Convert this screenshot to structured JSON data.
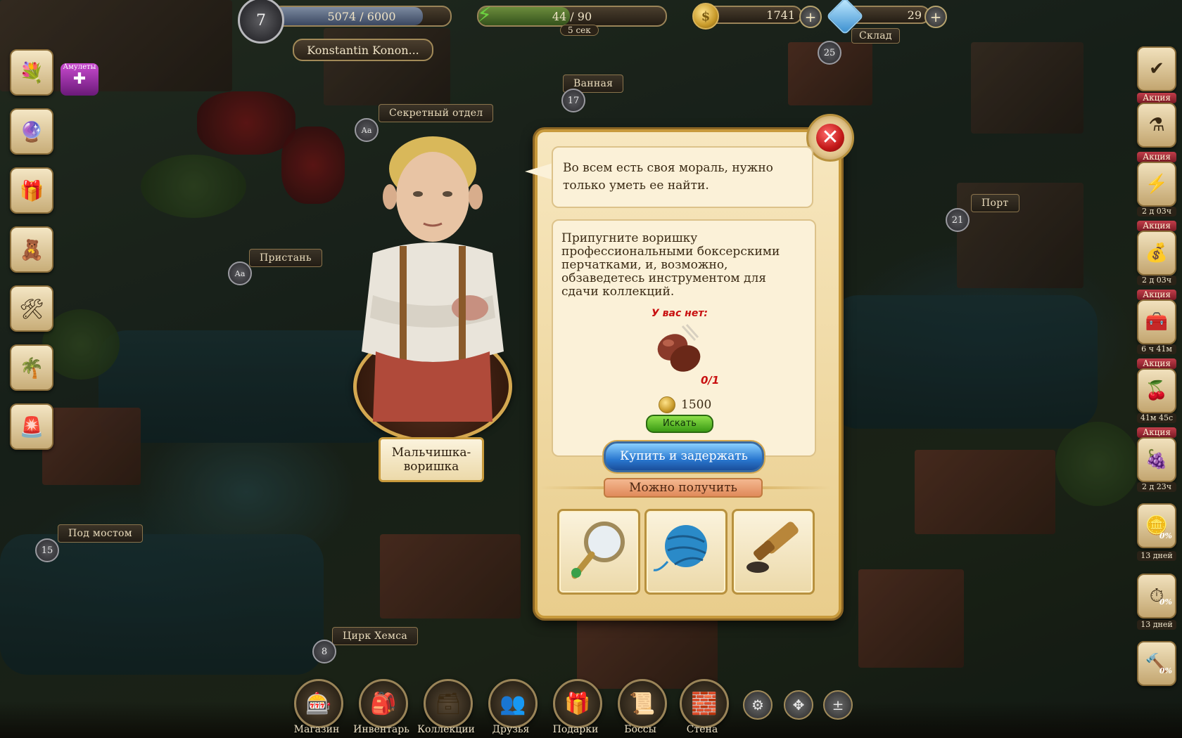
{
  "hud": {
    "level": "7",
    "xp_text": "5074 / 6000",
    "xp_fraction": 0.846,
    "energy_text": "44 / 90",
    "energy_fraction": 0.49,
    "energy_timer": "5 сек",
    "coins": "1741",
    "gems": "29",
    "player_name": "Konstantin Konon...",
    "warehouse_label": "Склад",
    "warehouse_level": "25"
  },
  "map": {
    "locations": [
      {
        "label": "Ванная",
        "level": "17"
      },
      {
        "label": "Секретный отдел",
        "level": "Аа"
      },
      {
        "label": "Пристань",
        "level": "Аа"
      },
      {
        "label": "Порт",
        "level": "21"
      },
      {
        "label": "Под мостом",
        "level": "15"
      },
      {
        "label": "Цирк Хемса",
        "level": "8"
      }
    ],
    "amulets_label": "Амулеты"
  },
  "right_panel": {
    "promo_label": "Акция",
    "timers": [
      "2 д 03ч",
      "2 д 03ч",
      "6 ч 41м",
      "41м 45с",
      "2 д 23ч",
      "13 дней",
      "13 дней"
    ],
    "percents": [
      "0%",
      "0%",
      "0%"
    ]
  },
  "character": {
    "name": "Мальчишка-воришка"
  },
  "dialog": {
    "quote": "Во всем есть своя мораль, нужно только уметь ее найти.",
    "task_text": "Припугните воришку профессиональными боксерскими перчатками, и, возможно, обзаведетесь инструментом для сдачи коллекций.",
    "missing_label": "У вас нет:",
    "item_count": "0/1",
    "price": "1500",
    "search_button": "Искать",
    "buy_button": "Купить и задержать",
    "can_get_label": "Можно получить",
    "rewards": [
      "magnifier-icon",
      "yarn-ball-icon",
      "spyglass-icon"
    ]
  },
  "bottom_nav": [
    {
      "label": "Магазин",
      "icon": "shop-icon"
    },
    {
      "label": "Инвентарь",
      "icon": "inventory-icon"
    },
    {
      "label": "Коллекции",
      "icon": "collections-icon"
    },
    {
      "label": "Друзья",
      "icon": "friends-icon"
    },
    {
      "label": "Подарки",
      "icon": "gifts-icon"
    },
    {
      "label": "Боссы",
      "icon": "bosses-icon"
    },
    {
      "label": "Стена",
      "icon": "wall-icon"
    }
  ],
  "colors": {
    "dialog_bg": "#f7e7bf",
    "frame_gold": "#c89a3c",
    "buy_blue": "#2a78d0",
    "search_green": "#3a9a14",
    "alert_red": "#c81010"
  }
}
